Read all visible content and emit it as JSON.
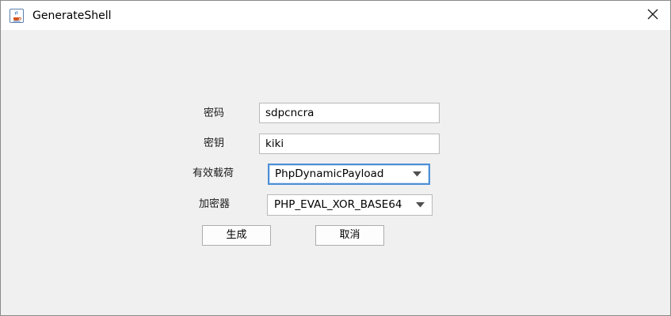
{
  "window": {
    "title": "GenerateShell",
    "app_icon": "java-coffee-cup-icon",
    "close_icon": "close-x-icon"
  },
  "form": {
    "password": {
      "label": "密码",
      "value": "sdpcncra"
    },
    "key": {
      "label": "密钥",
      "value": "kiki"
    },
    "payload": {
      "label": "有效载荷",
      "selected": "PhpDynamicPayload",
      "icon": "dropdown-arrow-icon"
    },
    "cryption": {
      "label": "加密器",
      "selected": "PHP_EVAL_XOR_BASE64",
      "icon": "dropdown-arrow-icon"
    }
  },
  "buttons": {
    "generate_label": "生成",
    "cancel_label": "取消"
  },
  "colors": {
    "window_bg": "#f0f0f0",
    "titlebar_bg": "#ffffff",
    "focus_border": "#4d8fd6"
  }
}
